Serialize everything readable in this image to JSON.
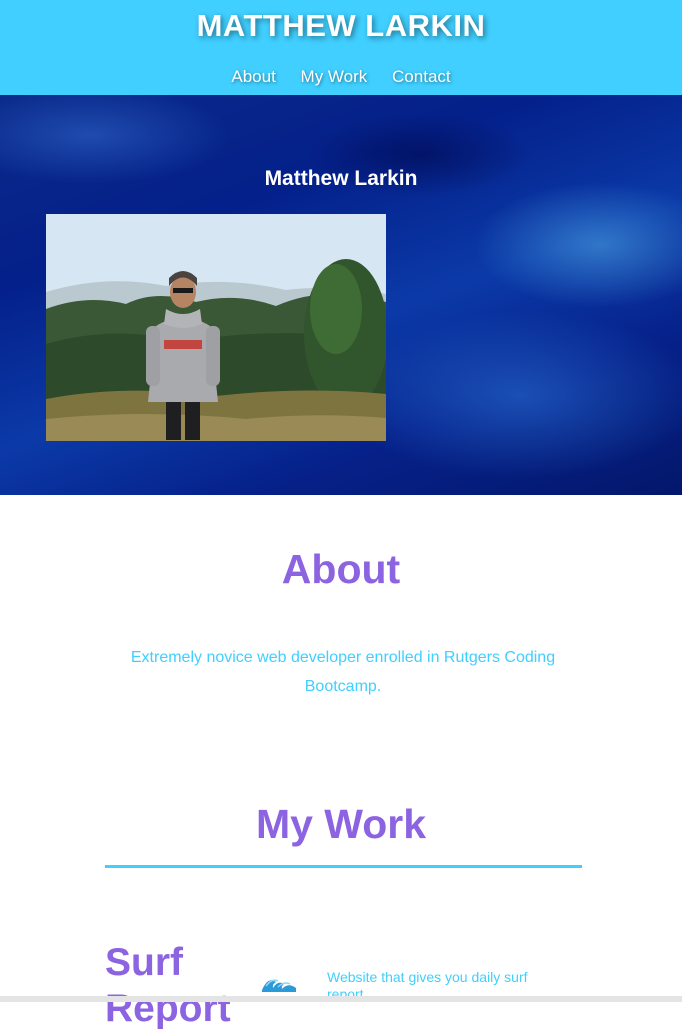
{
  "header": {
    "site_title": "MATTHEW LARKIN",
    "nav": [
      "About",
      "My Work",
      "Contact"
    ]
  },
  "hero": {
    "name": "Matthew Larkin",
    "photo_icon": "profile-photo"
  },
  "about": {
    "title": "About",
    "text": "Extremely novice web developer enrolled in Rutgers Coding Bootcamp."
  },
  "work": {
    "title": "My Work",
    "projects": [
      {
        "title": "Surf Report",
        "icon": "wave-icon",
        "description": "Website that gives you daily surf report"
      }
    ]
  },
  "colors": {
    "header_bg": "#40cfff",
    "accent_purple": "#8c63e0",
    "accent_cyan": "#40cfff",
    "hero_blue": "#0b3aa8"
  }
}
